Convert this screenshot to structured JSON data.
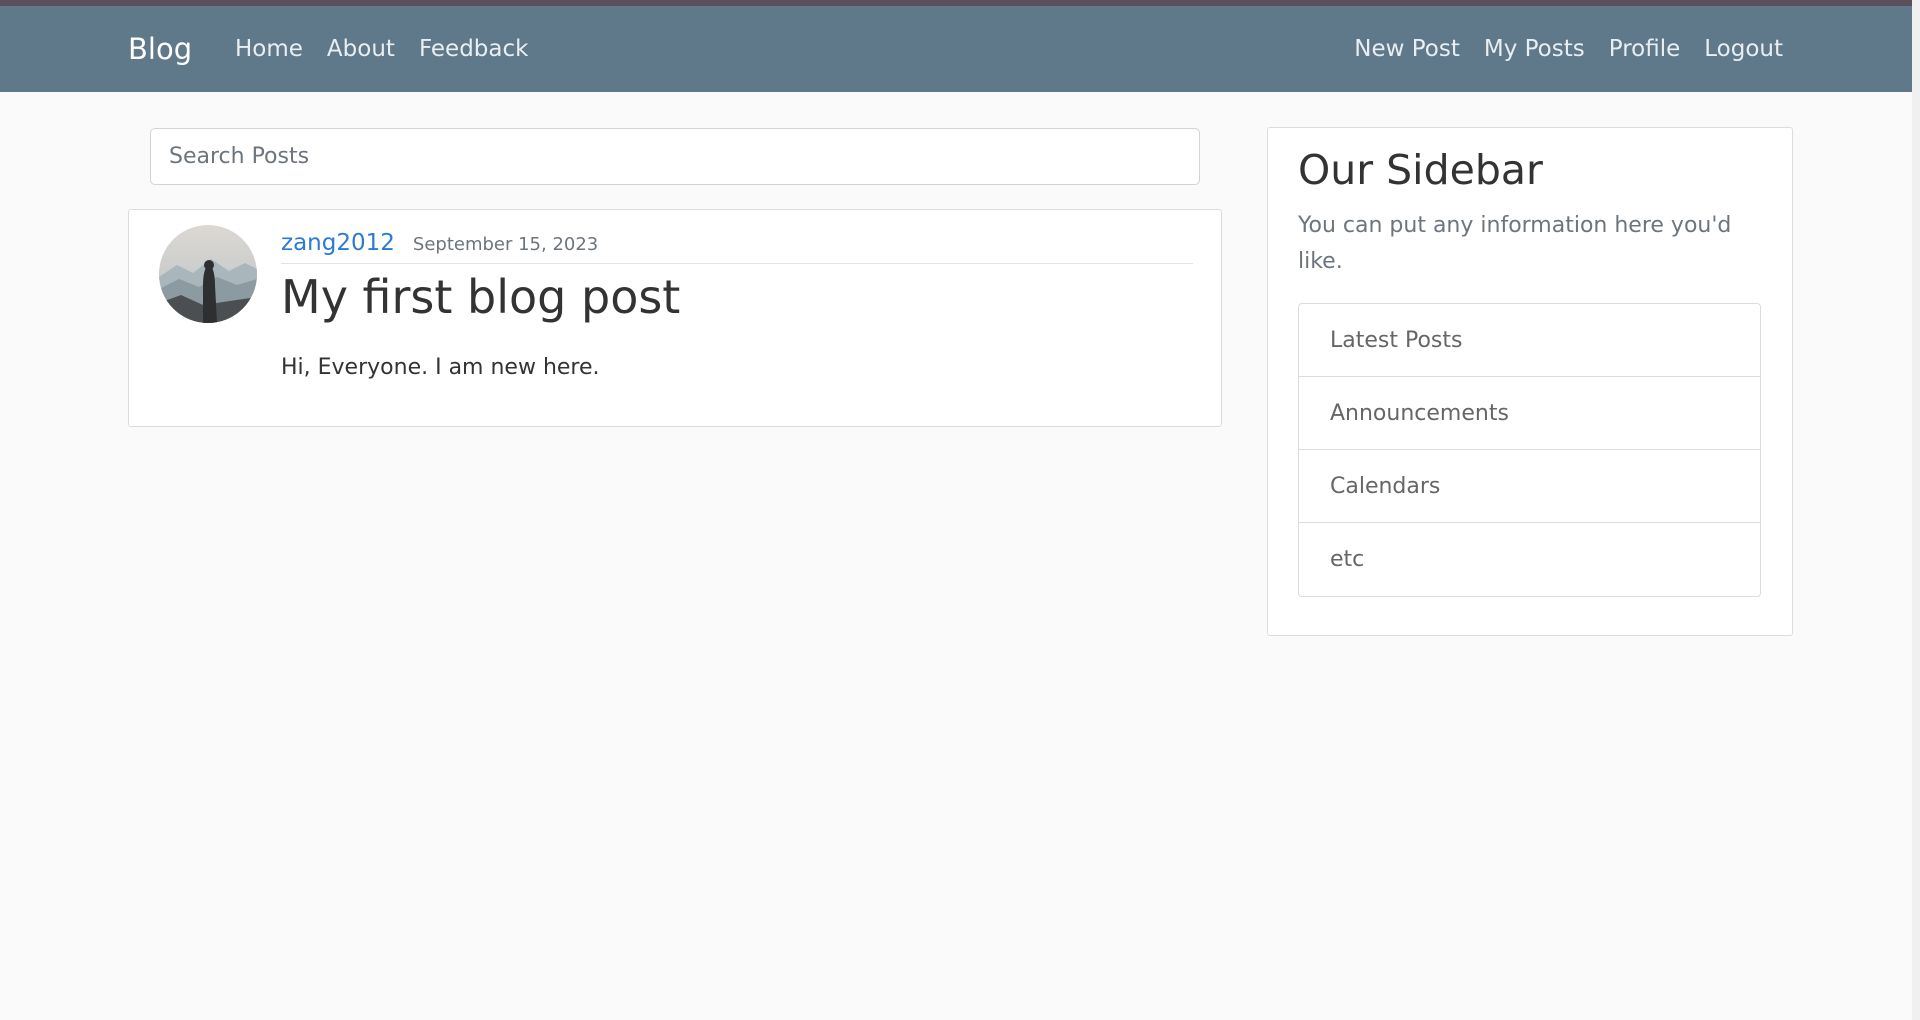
{
  "navbar": {
    "brand": "Blog",
    "left_links": [
      "Home",
      "About",
      "Feedback"
    ],
    "right_links": [
      "New Post",
      "My Posts",
      "Profile",
      "Logout"
    ]
  },
  "search": {
    "placeholder": "Search Posts",
    "value": ""
  },
  "post": {
    "author": "zang2012",
    "date": "September 15, 2023",
    "title": "My first blog post",
    "content": "Hi, Everyone. I am new here."
  },
  "sidebar": {
    "title": "Our Sidebar",
    "description": "You can put any information here you'd like.",
    "items": [
      "Latest Posts",
      "Announcements",
      "Calendars",
      "etc"
    ]
  },
  "colors": {
    "navbar_bg": "#5f788a",
    "top_strip": "#5a4f5b",
    "link_blue": "#2b7bd4",
    "page_bg": "#fafafa"
  }
}
